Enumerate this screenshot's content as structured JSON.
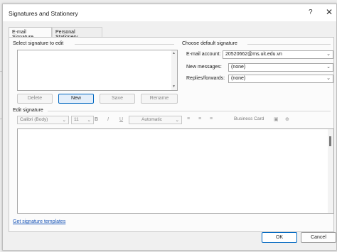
{
  "dialog": {
    "title": "Signatures and Stationery",
    "help_glyph": "?",
    "close_glyph": "✕"
  },
  "tabs": [
    {
      "label": "E-mail Signature",
      "active": true
    },
    {
      "label": "Personal Stationery",
      "active": false
    }
  ],
  "select_signature": {
    "label": "Select signature to edit",
    "items": []
  },
  "signature_buttons": {
    "delete": "Delete",
    "new": "New",
    "save": "Save",
    "rename": "Rename"
  },
  "default_signature": {
    "label": "Choose default signature",
    "email_account_label": "E-mail account:",
    "email_account_value": "20520662@ms.uit.edu.vn",
    "new_messages_label": "New messages:",
    "new_messages_value": "(none)",
    "replies_label": "Replies/forwards:",
    "replies_value": "(none)"
  },
  "edit_signature": {
    "label": "Edit signature",
    "font": "Calibri (Body)",
    "size": "11",
    "bold": "B",
    "italic": "I",
    "underline": "U",
    "color": "Automatic",
    "business_card": "Business Card"
  },
  "footer": {
    "templates_link": "Get signature templates",
    "ok": "OK",
    "cancel": "Cancel"
  },
  "colors": {
    "accent": "#0067c0",
    "link": "#1a56b8"
  }
}
